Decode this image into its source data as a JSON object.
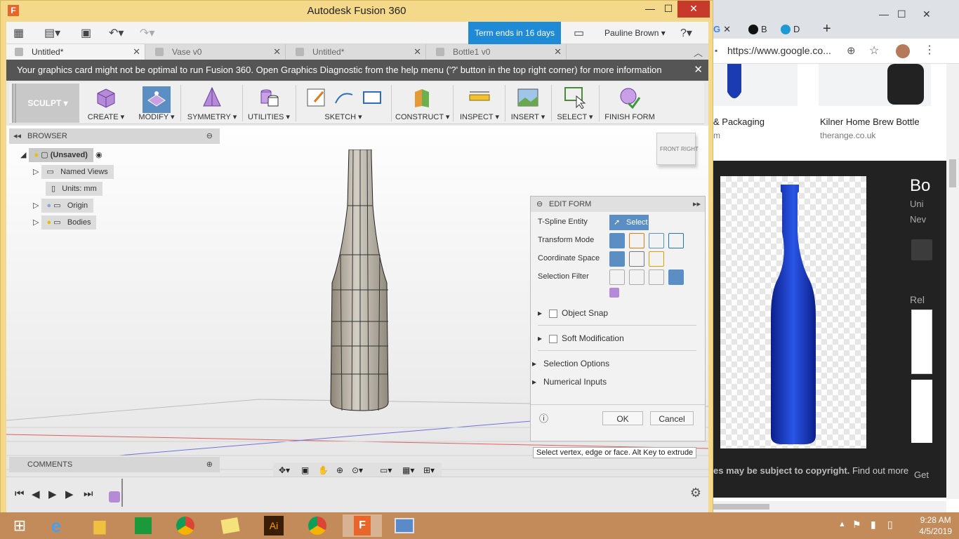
{
  "window": {
    "title": "Autodesk Fusion 360",
    "app_letter": "F",
    "minimize": "—",
    "maximize": "☐",
    "close": "✕"
  },
  "quickbar": {
    "term_label": "Term ends in 16 days",
    "user_name": "Pauline Brown",
    "help": "?"
  },
  "doc_tabs": [
    {
      "label": "Untitled*",
      "active": true
    },
    {
      "label": "Vase v0",
      "active": false
    },
    {
      "label": "Untitled*",
      "active": false
    },
    {
      "label": "Bottle1 v0",
      "active": false
    }
  ],
  "warning": {
    "text": "Your graphics card might not be optimal to run Fusion 360. Open Graphics Diagnostic from the help menu ('?' button in the top right corner) for more information"
  },
  "toolbar": {
    "workspace": "SCULPT",
    "groups": [
      "CREATE",
      "MODIFY",
      "SYMMETRY",
      "UTILITIES",
      "SKETCH",
      "CONSTRUCT",
      "INSPECT",
      "INSERT",
      "SELECT",
      "FINISH FORM"
    ]
  },
  "browser": {
    "header": "BROWSER",
    "root": "(Unsaved)",
    "items": [
      "Named Views",
      "Units: mm",
      "Origin",
      "Bodies"
    ]
  },
  "comments": {
    "header": "COMMENTS"
  },
  "viewcube": {
    "front": "FRONT",
    "right": "RIGHT"
  },
  "edit_form": {
    "header": "EDIT FORM",
    "tspline_label": "T-Spline Entity",
    "select_btn": "Select",
    "transform_label": "Transform Mode",
    "coordinate_label": "Coordinate Space",
    "selection_filter_label": "Selection Filter",
    "object_snap": "Object Snap",
    "soft_mod": "Soft Modification",
    "selection_options": "Selection Options",
    "numerical_inputs": "Numerical Inputs",
    "ok": "OK",
    "cancel": "Cancel",
    "tooltip": "Select vertex, edge or face. Alt Key to extrude"
  },
  "chrome": {
    "url": "https://www.google.co...",
    "tab_glyphs": [
      "G",
      "B",
      "D"
    ],
    "result1_title": "& Packaging",
    "result1_source": "m",
    "result2_title": "Kilner Home Brew Bottle",
    "result2_source": "therange.co.uk",
    "side_title": "Bo",
    "side_sub1": "Uni",
    "side_sub2": "Nev",
    "side_related": "Rel",
    "copyright": "es may be subject to copyright.",
    "find_out_more": "Find out more",
    "get": "Get"
  },
  "taskbar": {
    "time": "9:28 AM",
    "date": "4/5/2019",
    "apps": [
      "start",
      "ie",
      "explorer",
      "store",
      "chrome",
      "sticky",
      "illustrator",
      "chrome",
      "fusion",
      "photos"
    ],
    "ai_label": "Ai"
  }
}
